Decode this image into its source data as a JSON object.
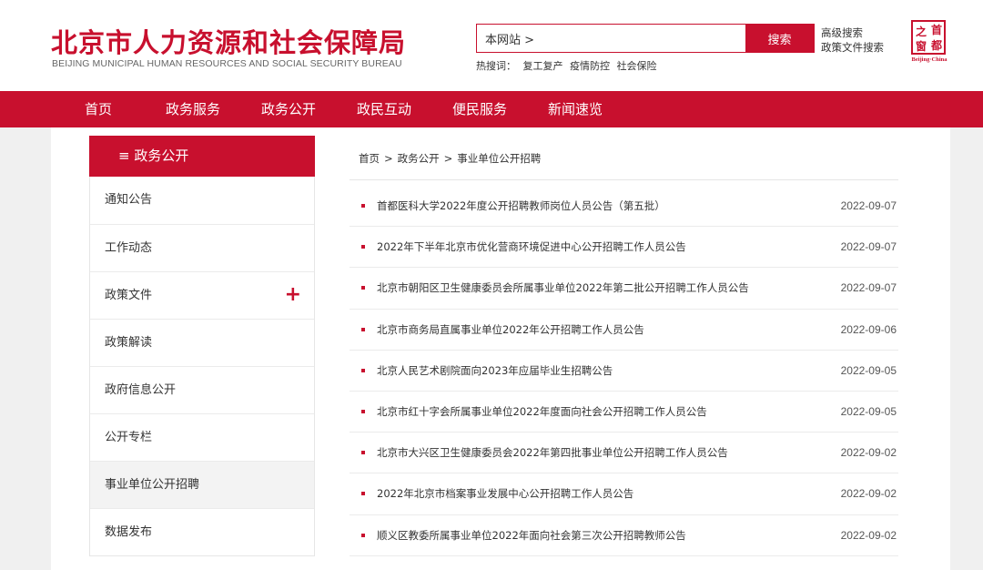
{
  "header": {
    "logo_cn": "北京市人力资源和社会保障局",
    "logo_en": "BEIJING MUNICIPAL HUMAN RESOURCES AND SOCIAL SECURITY BUREAU",
    "search_value": "本网站 >",
    "search_button": "搜索",
    "advanced_search": "高级搜索",
    "policy_search": "政策文件搜索",
    "hot_label": "热搜词：",
    "hot_words": [
      "复工复产",
      "疫情防控",
      "社会保险"
    ],
    "badge_chars": [
      "之",
      "首",
      "窗",
      "都"
    ],
    "badge_sub": "Beijing·China"
  },
  "nav": {
    "items": [
      "首页",
      "政务服务",
      "政务公开",
      "政民互动",
      "便民服务",
      "新闻速览"
    ]
  },
  "sidebar": {
    "title": "≡ 政务公开",
    "items": [
      {
        "label": "通知公告"
      },
      {
        "label": "工作动态"
      },
      {
        "label": "政策文件",
        "expand": "+"
      },
      {
        "label": "政策解读"
      },
      {
        "label": "政府信息公开"
      },
      {
        "label": "公开专栏"
      },
      {
        "label": "事业单位公开招聘"
      },
      {
        "label": "数据发布"
      }
    ]
  },
  "breadcrumb": [
    "首页",
    "政务公开",
    "事业单位公开招聘"
  ],
  "list": [
    {
      "title": "首都医科大学2022年度公开招聘教师岗位人员公告（第五批）",
      "date": "2022-09-07"
    },
    {
      "title": "2022年下半年北京市优化营商环境促进中心公开招聘工作人员公告",
      "date": "2022-09-07"
    },
    {
      "title": "北京市朝阳区卫生健康委员会所属事业单位2022年第二批公开招聘工作人员公告",
      "date": "2022-09-07"
    },
    {
      "title": "北京市商务局直属事业单位2022年公开招聘工作人员公告",
      "date": "2022-09-06"
    },
    {
      "title": "北京人民艺术剧院面向2023年应届毕业生招聘公告",
      "date": "2022-09-05"
    },
    {
      "title": "北京市红十字会所属事业单位2022年度面向社会公开招聘工作人员公告",
      "date": "2022-09-05"
    },
    {
      "title": "北京市大兴区卫生健康委员会2022年第四批事业单位公开招聘工作人员公告",
      "date": "2022-09-02"
    },
    {
      "title": "2022年北京市档案事业发展中心公开招聘工作人员公告",
      "date": "2022-09-02"
    },
    {
      "title": "顺义区教委所属事业单位2022年面向社会第三次公开招聘教师公告",
      "date": "2022-09-02"
    }
  ],
  "colors": {
    "brand_red": "#c8102e",
    "background": "#f0f0f0"
  }
}
